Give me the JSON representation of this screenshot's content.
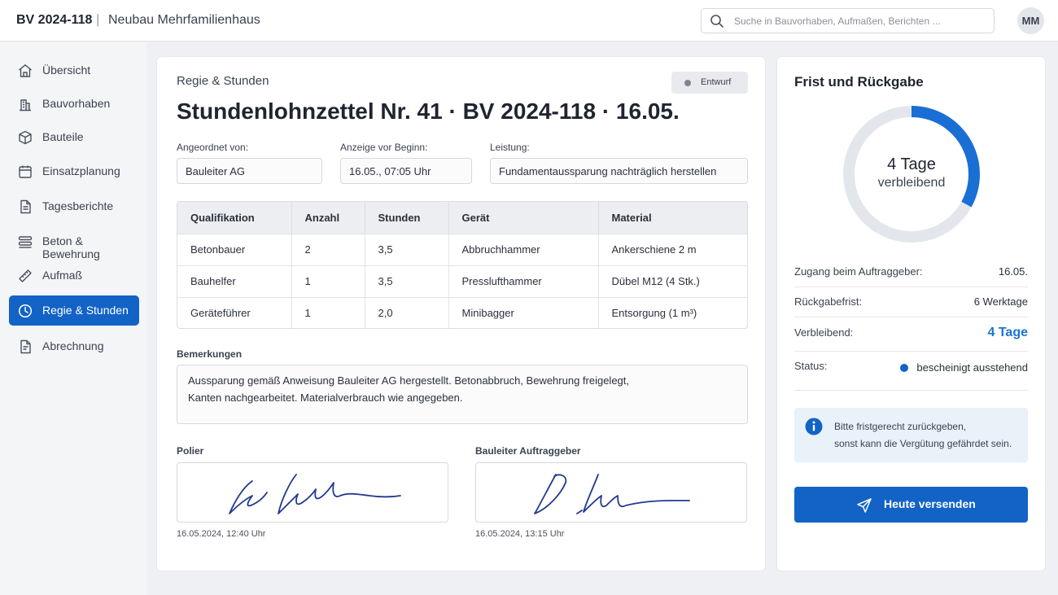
{
  "header": {
    "project_code": "BV 2024-118",
    "separator": "|",
    "project_name": "Neubau Mehrfamilienhaus",
    "search_placeholder": "Suche in Bauvorhaben, Aufmaßen, Berichten ...",
    "avatar_initials": "MM"
  },
  "sidebar": {
    "items": [
      {
        "label": "Übersicht",
        "icon": "home-icon"
      },
      {
        "label": "Bauvorhaben",
        "icon": "building-icon"
      },
      {
        "label": "Bauteile",
        "icon": "cube-icon"
      },
      {
        "label": "Einsatzplanung",
        "icon": "calendar-icon"
      },
      {
        "label": "Tagesberichte",
        "icon": "document-icon"
      },
      {
        "label": "Beton & Bewehrung",
        "icon": "layers-icon"
      },
      {
        "label": "Aufmaß",
        "icon": "ruler-icon"
      },
      {
        "label": "Regie & Stunden",
        "icon": "clock-icon",
        "active": true
      },
      {
        "label": "Abrechnung",
        "icon": "invoice-icon"
      }
    ]
  },
  "doc": {
    "breadcrumb": "Regie & Stunden",
    "status": "Entwurf",
    "title": "Stundenlohnzettel Nr. 41 · BV 2024-118 · 16.05.",
    "fields": {
      "ordered_by_label": "Angeordnet von:",
      "ordered_by_value": "Bauleiter AG",
      "notice_label": "Anzeige vor Beginn:",
      "notice_value": "16.05., 07:05 Uhr",
      "service_label": "Leistung:",
      "service_value": "Fundamentaussparung nachträglich herstellen"
    },
    "table": {
      "headers": [
        "Qualifikation",
        "Anzahl",
        "Stunden",
        "Gerät",
        "Material"
      ],
      "rows": [
        [
          "Betonbauer",
          "2",
          "3,5",
          "Abbruchhammer",
          "Ankerschiene 2 m"
        ],
        [
          "Bauhelfer",
          "1",
          "3,5",
          "Presslufthammer",
          "Dübel M12 (4 Stk.)"
        ],
        [
          "Geräteführer",
          "1",
          "2,0",
          "Minibagger",
          "Entsorgung (1 m³)"
        ]
      ]
    },
    "remarks_label": "Bemerkungen",
    "remarks_line1": "Aussparung gemäß Anweisung Bauleiter AG hergestellt. Betonabbruch, Bewehrung freigelegt,",
    "remarks_line2": "Kanten nachgearbeitet. Materialverbrauch wie angegeben.",
    "signatures": [
      {
        "label": "Polier",
        "timestamp": "16.05.2024, 12:40 Uhr"
      },
      {
        "label": "Bauleiter Auftraggeber",
        "timestamp": "16.05.2024, 13:15 Uhr"
      }
    ]
  },
  "panel": {
    "title": "Frist und Rückgabe",
    "donut": {
      "main": "4 Tage",
      "sub": "verbleibend",
      "fraction_remaining": 0.33,
      "color": "#1a6fd4",
      "track_color": "#e3e7ec"
    },
    "details": [
      {
        "label": "Zugang beim Auftraggeber:",
        "value": "16.05."
      },
      {
        "label": "Rückgabefrist:",
        "value": "6 Werktage"
      },
      {
        "label": "Verbleibend:",
        "value": "4 Tage"
      },
      {
        "label": "Status:",
        "value": "bescheinigt ausstehend"
      }
    ],
    "info_line1": "Bitte fristgerecht zurückgeben,",
    "info_line2": "sonst kann die Vergütung gefährdet sein.",
    "send_label": "Heute versenden"
  }
}
